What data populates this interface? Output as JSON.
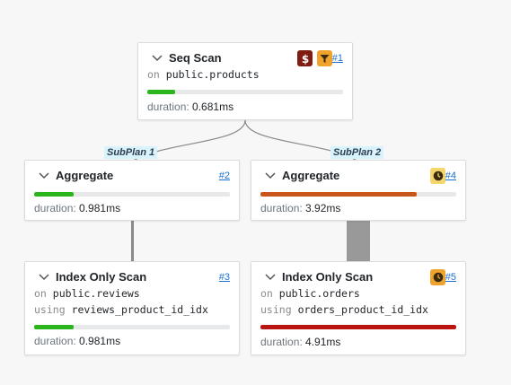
{
  "nodes": {
    "seq_scan": {
      "title": "Seq Scan",
      "id_label": "#1",
      "on_kw": "on",
      "relation": "public.products",
      "duration_label": "duration:",
      "duration": "0.681ms",
      "progress": 0.14,
      "bar_color": "#2bb51c",
      "badges": [
        "cost-icon",
        "filter-icon"
      ]
    },
    "aggregate1": {
      "title": "Aggregate",
      "id_label": "#2",
      "duration_label": "duration:",
      "duration": "0.981ms",
      "progress": 0.2,
      "bar_color": "#2bb51c"
    },
    "aggregate2": {
      "title": "Aggregate",
      "id_label": "#4",
      "duration_label": "duration:",
      "duration": "3.92ms",
      "progress": 0.8,
      "bar_color": "#c8561a",
      "badges": [
        "clock-icon"
      ]
    },
    "index_scan1": {
      "title": "Index Only Scan",
      "id_label": "#3",
      "on_kw": "on",
      "relation": "public.reviews",
      "using_kw": "using",
      "index": "reviews_product_id_idx",
      "duration_label": "duration:",
      "duration": "0.981ms",
      "progress": 0.2,
      "bar_color": "#2bb51c"
    },
    "index_scan2": {
      "title": "Index Only Scan",
      "id_label": "#5",
      "on_kw": "on",
      "relation": "public.orders",
      "using_kw": "using",
      "index": "orders_product_id_idx",
      "duration_label": "duration:",
      "duration": "4.91ms",
      "progress": 1.0,
      "bar_color": "#b9140f",
      "badges": [
        "clock-icon"
      ]
    }
  },
  "subplans": {
    "left": "SubPlan 1",
    "right": "SubPlan 2"
  },
  "colors": {
    "edge": "#888888",
    "id_link": "#1a6fd1",
    "subplan_bg": "#d8f3fb"
  }
}
